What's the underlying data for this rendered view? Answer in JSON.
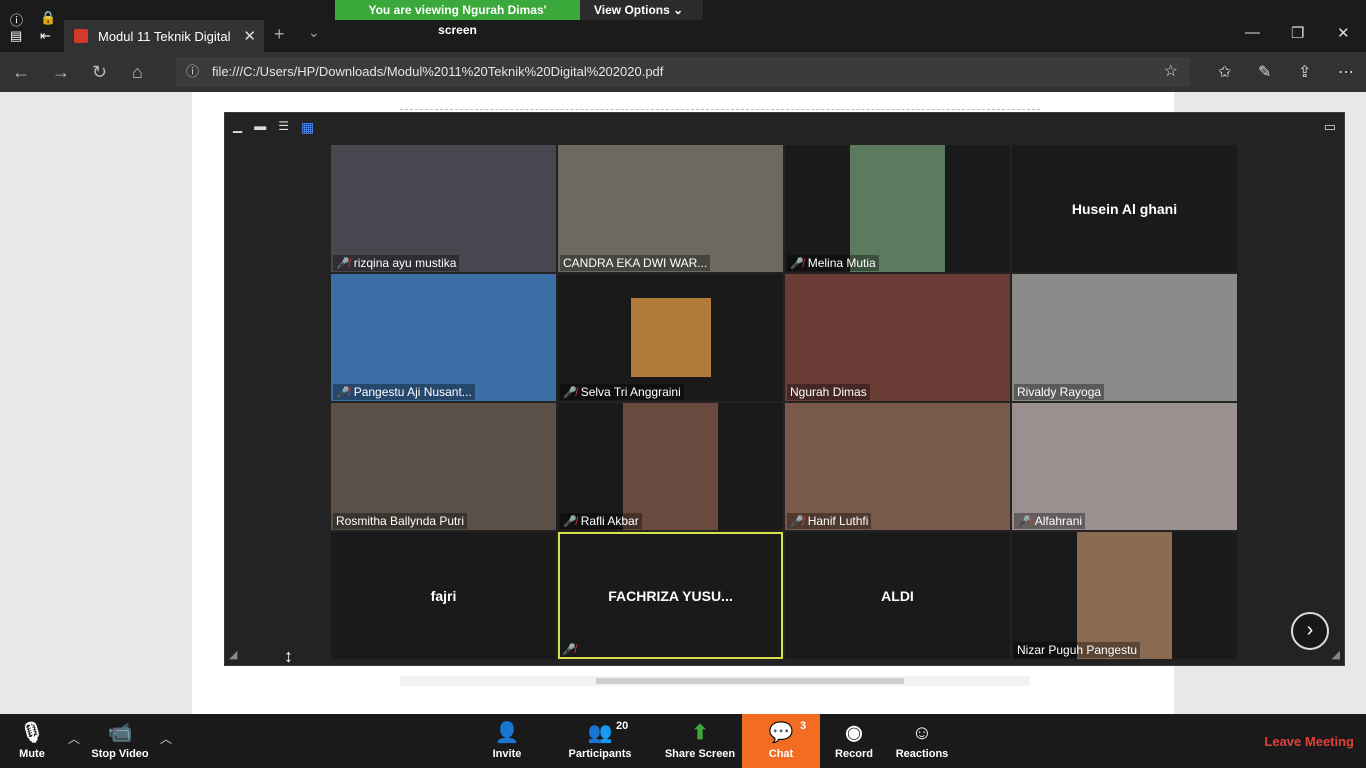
{
  "zoom_banner": {
    "viewing_text": "You are viewing Ngurah Dimas' screen",
    "view_options": "View Options"
  },
  "browser": {
    "tab_title": "Modul 11 Teknik Digital",
    "url": "file:///C:/Users/HP/Downloads/Modul%2011%20Teknik%20Digital%202020.pdf"
  },
  "participants_tiles": [
    {
      "name": "rizqina ayu mustika",
      "muted": true,
      "video": true,
      "color": "#4a4650"
    },
    {
      "name": "CANDRA EKA DWI WAR...",
      "muted": false,
      "video": true,
      "color": "#6c6a60"
    },
    {
      "name": "Melina Mutia",
      "muted": true,
      "video": true,
      "color": "#5b7a5e"
    },
    {
      "name": "Husein Al ghani",
      "muted": false,
      "video": false
    },
    {
      "name": "Pangestu Aji Nusant...",
      "muted": true,
      "video": true,
      "color": "#3a6ea5"
    },
    {
      "name": "Selva Tri Anggraini",
      "muted": true,
      "video": true,
      "color": "#b07a3a"
    },
    {
      "name": "Ngurah Dimas",
      "muted": false,
      "video": true,
      "color": "#6a3e36"
    },
    {
      "name": "Rivaldy Rayoga",
      "muted": false,
      "video": true,
      "color": "#8a8a88"
    },
    {
      "name": "Rosmitha Ballynda Putri",
      "muted": false,
      "video": true,
      "color": "#5a5048"
    },
    {
      "name": "Rafli Akbar",
      "muted": true,
      "video": true,
      "color": "#6a4a3e"
    },
    {
      "name": "Hanif Luthfi",
      "muted": true,
      "video": true,
      "color": "#7a5a4a"
    },
    {
      "name": "Alfahrani",
      "muted": true,
      "video": true,
      "color": "#9a9090"
    },
    {
      "name": "fajri",
      "muted": false,
      "video": false
    },
    {
      "name": "FACHRIZA YUSU...",
      "muted": true,
      "video": false,
      "active": true
    },
    {
      "name": "ALDI",
      "muted": false,
      "video": false
    },
    {
      "name": "Nizar Puguh Pangestu",
      "muted": false,
      "video": true,
      "color": "#8a6a50"
    }
  ],
  "toolbar": {
    "mute": "Mute",
    "stop_video": "Stop Video",
    "invite": "Invite",
    "participants": "Participants",
    "participants_count": "20",
    "share_screen": "Share Screen",
    "chat": "Chat",
    "chat_count": "3",
    "record": "Record",
    "reactions": "Reactions",
    "leave": "Leave Meeting"
  },
  "colors": {
    "share_green": "#3aa83a",
    "chat_orange": "#f26d21",
    "leave_red": "#e0413c",
    "active_speaker": "#d7e24a"
  }
}
